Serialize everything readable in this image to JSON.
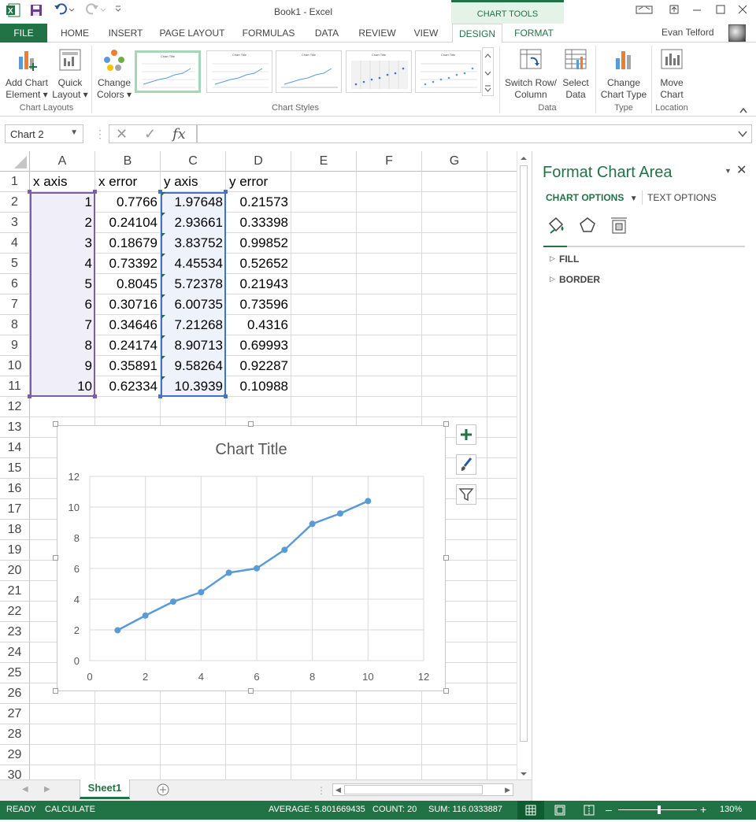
{
  "title_bar": {
    "app_title": "Book1 - Excel",
    "contextual_tools": "CHART TOOLS",
    "user_name": "Evan Telford"
  },
  "ribbon_tabs": [
    "FILE",
    "HOME",
    "INSERT",
    "PAGE LAYOUT",
    "FORMULAS",
    "DATA",
    "REVIEW",
    "VIEW",
    "DESIGN",
    "FORMAT"
  ],
  "ribbon": {
    "add_chart_element": [
      "Add Chart",
      "Element"
    ],
    "quick_layout": [
      "Quick",
      "Layout"
    ],
    "change_colors": [
      "Change",
      "Colors"
    ],
    "switch_row_column": [
      "Switch Row/",
      "Column"
    ],
    "select_data": [
      "Select",
      "Data"
    ],
    "change_chart_type": [
      "Change",
      "Chart Type"
    ],
    "move_chart": [
      "Move",
      "Chart"
    ],
    "groups": {
      "chart_layouts": "Chart Layouts",
      "chart_styles": "Chart Styles",
      "data": "Data",
      "type": "Type",
      "location": "Location"
    },
    "style_thumb_title": "Chart Title"
  },
  "formula_bar": {
    "name_box": "Chart 2",
    "fx": "fx",
    "formula": ""
  },
  "columns": [
    "A",
    "B",
    "C",
    "D",
    "E",
    "F",
    "G"
  ],
  "rows": [
    "1",
    "2",
    "3",
    "4",
    "5",
    "6",
    "7",
    "8",
    "9",
    "10",
    "11",
    "12",
    "13",
    "14",
    "15",
    "16",
    "17",
    "18",
    "19",
    "20",
    "21",
    "22",
    "23",
    "24",
    "25",
    "26",
    "27",
    "28",
    "29",
    "30"
  ],
  "sheet": {
    "headers": [
      "x axis",
      "x error",
      "y axis",
      "y error"
    ],
    "data": [
      [
        "1",
        "0.7766",
        "1.97648",
        "0.21573"
      ],
      [
        "2",
        "0.24104",
        "2.93661",
        "0.33398"
      ],
      [
        "3",
        "0.18679",
        "3.83752",
        "0.99852"
      ],
      [
        "4",
        "0.73392",
        "4.45534",
        "0.52652"
      ],
      [
        "5",
        "0.8045",
        "5.72378",
        "0.21943"
      ],
      [
        "6",
        "0.30716",
        "6.00735",
        "0.73596"
      ],
      [
        "7",
        "0.34646",
        "7.21268",
        "0.4316"
      ],
      [
        "8",
        "0.24174",
        "8.90713",
        "0.69993"
      ],
      [
        "9",
        "0.35891",
        "9.58264",
        "0.92287"
      ],
      [
        "10",
        "0.62334",
        "10.3939",
        "0.10988"
      ]
    ]
  },
  "chart_data": {
    "type": "scatter",
    "title": "Chart Title",
    "series": [
      {
        "x": [
          1,
          2,
          3,
          4,
          5,
          6,
          7,
          8,
          9,
          10
        ],
        "y": [
          1.97648,
          2.93661,
          3.83752,
          4.45534,
          5.72378,
          6.00735,
          7.21268,
          8.90713,
          9.58264,
          10.3939
        ],
        "color": "#5b9bd5"
      }
    ],
    "xlim": [
      0,
      12
    ],
    "ylim": [
      0,
      12
    ],
    "xticks": [
      "0",
      "2",
      "4",
      "6",
      "8",
      "10",
      "12"
    ],
    "yticks": [
      "0",
      "2",
      "4",
      "6",
      "8",
      "10",
      "12"
    ],
    "grid": true
  },
  "format_pane": {
    "title": "Format Chart Area",
    "chart_options": "CHART OPTIONS",
    "text_options": "TEXT OPTIONS",
    "sections": [
      "FILL",
      "BORDER"
    ]
  },
  "sheet_tab": "Sheet1",
  "status_bar": {
    "ready": "READY",
    "calculate": "CALCULATE",
    "average": "AVERAGE: 5.801669435",
    "count": "COUNT: 20",
    "sum": "SUM: 116.0333887",
    "zoom": "130%"
  },
  "colors": {
    "excel_green": "#217346",
    "series_blue": "#5b9bd5",
    "selection_purple": "#7b5ea7",
    "selection_blue": "#4472c4"
  }
}
